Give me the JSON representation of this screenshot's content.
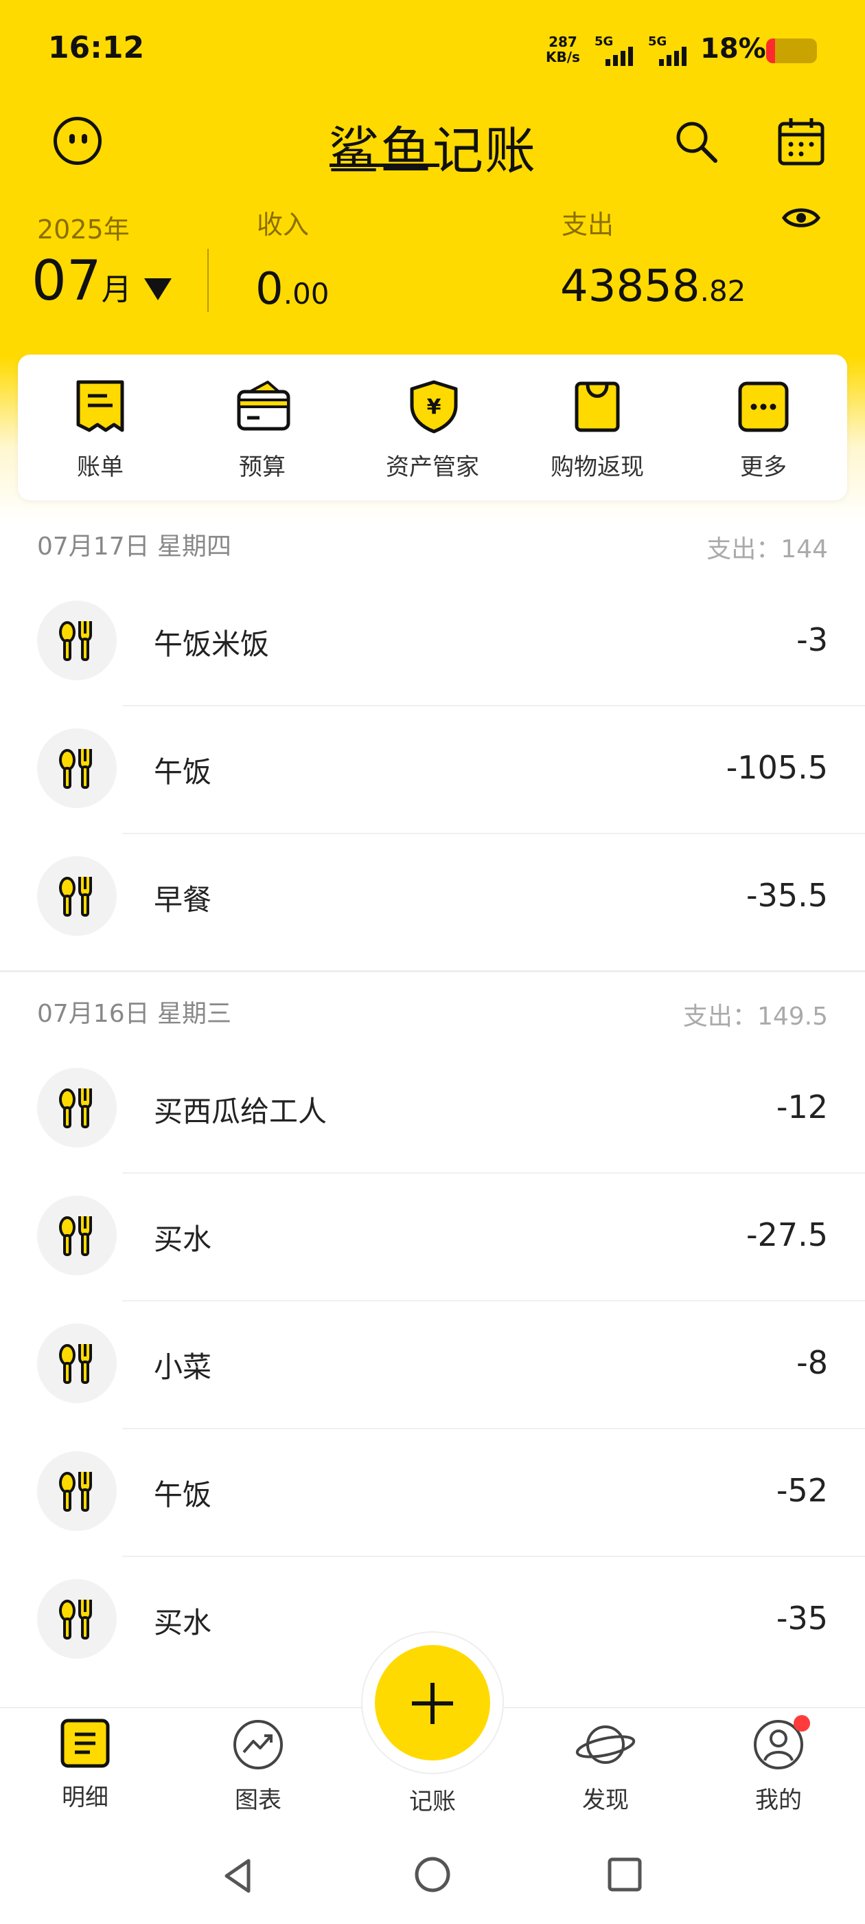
{
  "status_bar": {
    "time": "16:12",
    "net_speed": "287",
    "net_unit": "KB/s",
    "sim1": "5G",
    "sim2": "5G",
    "battery": "18%",
    "battery_level": 0.18
  },
  "header": {
    "app_title": "鲨鱼记账"
  },
  "summary": {
    "year": "2025年",
    "month": "07",
    "month_unit": "月",
    "income_label": "收入",
    "income_int": "0",
    "income_dec": ".00",
    "expense_label": "支出",
    "expense_int": "43858",
    "expense_dec": ".82"
  },
  "quick_actions": [
    {
      "label": "账单",
      "icon": "bill-icon"
    },
    {
      "label": "预算",
      "icon": "budget-wallet-icon"
    },
    {
      "label": "资产管家",
      "icon": "asset-shield-icon"
    },
    {
      "label": "购物返现",
      "icon": "shopping-bag-icon"
    },
    {
      "label": "更多",
      "icon": "more-icon"
    }
  ],
  "days": [
    {
      "date": "07月17日 星期四",
      "sum_label": "支出：",
      "sum": "144",
      "items": [
        {
          "name": "午饭米饭",
          "amount": "-3",
          "icon": "fork-spoon-icon"
        },
        {
          "name": "午饭",
          "amount": "-105.5",
          "icon": "fork-spoon-icon"
        },
        {
          "name": "早餐",
          "amount": "-35.5",
          "icon": "fork-spoon-icon"
        }
      ]
    },
    {
      "date": "07月16日 星期三",
      "sum_label": "支出：",
      "sum": "149.5",
      "items": [
        {
          "name": "买西瓜给工人",
          "amount": "-12",
          "icon": "fork-spoon-icon"
        },
        {
          "name": "买水",
          "amount": "-27.5",
          "icon": "fork-spoon-icon"
        },
        {
          "name": "小菜",
          "amount": "-8",
          "icon": "fork-spoon-icon"
        },
        {
          "name": "午饭",
          "amount": "-52",
          "icon": "fork-spoon-icon"
        },
        {
          "name": "买水",
          "amount": "-35",
          "icon": "fork-spoon-icon"
        }
      ]
    }
  ],
  "tabs": [
    {
      "label": "明细",
      "icon": "detail-list-icon",
      "active": true
    },
    {
      "label": "图表",
      "icon": "chart-trend-icon"
    },
    {
      "label": "记账",
      "icon": "add-icon"
    },
    {
      "label": "发现",
      "icon": "planet-icon"
    },
    {
      "label": "我的",
      "icon": "profile-icon",
      "badge": true
    }
  ],
  "colors": {
    "brand": "#FFDA00",
    "badge": "#ff3b3b"
  }
}
